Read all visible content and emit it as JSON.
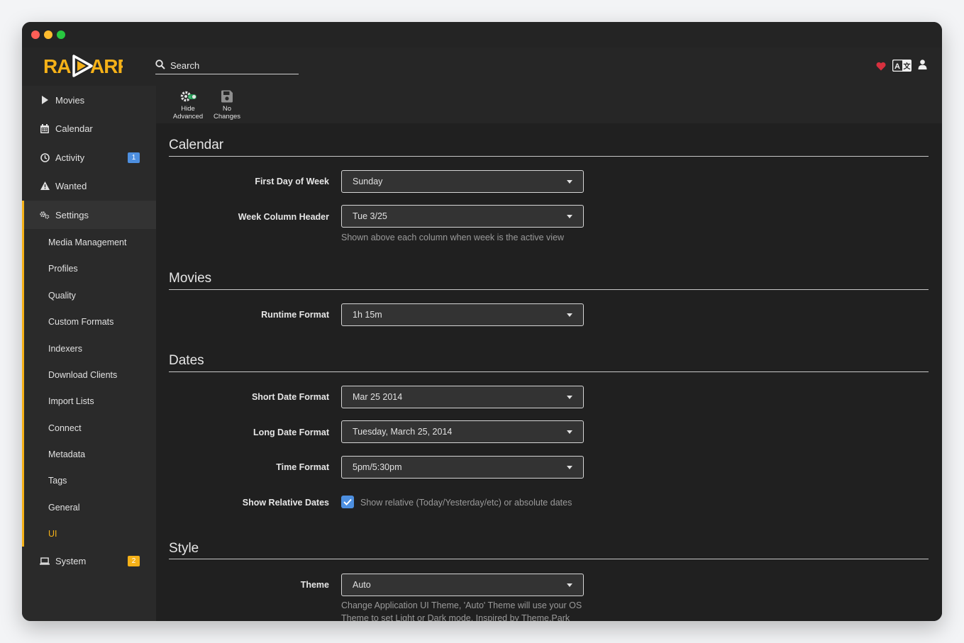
{
  "app": {
    "name": "RADARR",
    "accent": "#f5b118"
  },
  "header": {
    "search_placeholder": "Search",
    "icons": [
      "heart-icon",
      "translate-icon",
      "user-icon"
    ]
  },
  "sidebar": {
    "items": [
      {
        "label": "Movies",
        "icon": "play-icon"
      },
      {
        "label": "Calendar",
        "icon": "calendar-icon"
      },
      {
        "label": "Activity",
        "icon": "clock-icon",
        "badge": "1",
        "badge_color": "#4d8fe0"
      },
      {
        "label": "Wanted",
        "icon": "warning-icon"
      },
      {
        "label": "Settings",
        "icon": "cogs-icon"
      },
      {
        "label": "System",
        "icon": "laptop-icon",
        "badge": "2",
        "badge_color": "#f5b118"
      }
    ],
    "settings_sub": [
      "Media Management",
      "Profiles",
      "Quality",
      "Custom Formats",
      "Indexers",
      "Download Clients",
      "Import Lists",
      "Connect",
      "Metadata",
      "Tags",
      "General",
      "UI"
    ],
    "active_sub": "UI"
  },
  "toolbar": {
    "hide_advanced_1": "Hide",
    "hide_advanced_2": "Advanced",
    "no_changes_1": "No",
    "no_changes_2": "Changes"
  },
  "sections": {
    "calendar": {
      "title": "Calendar",
      "first_day_label": "First Day of Week",
      "first_day_value": "Sunday",
      "week_header_label": "Week Column Header",
      "week_header_value": "Tue 3/25",
      "week_header_help": "Shown above each column when week is the active view"
    },
    "movies": {
      "title": "Movies",
      "runtime_label": "Runtime Format",
      "runtime_value": "1h 15m"
    },
    "dates": {
      "title": "Dates",
      "short_date_label": "Short Date Format",
      "short_date_value": "Mar 25 2014",
      "long_date_label": "Long Date Format",
      "long_date_value": "Tuesday, March 25, 2014",
      "time_label": "Time Format",
      "time_value": "5pm/5:30pm",
      "relative_label": "Show Relative Dates",
      "relative_checked": true,
      "relative_help": "Show relative (Today/Yesterday/etc) or absolute dates"
    },
    "style": {
      "title": "Style",
      "theme_label": "Theme",
      "theme_value": "Auto",
      "theme_help_1": "Change Application UI Theme, 'Auto' Theme will use your OS",
      "theme_help_2": "Theme to set Light or Dark mode. Inspired by Theme.Park"
    }
  }
}
